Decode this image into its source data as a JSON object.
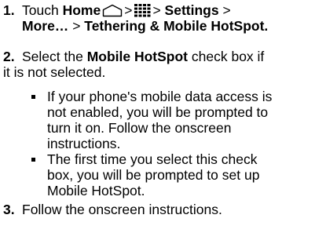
{
  "step1": {
    "number": "1.",
    "touch": "Touch",
    "home": "Home",
    "sep1": ">",
    "sep2": ">",
    "settings": "Settings",
    "sep3": ">",
    "more": "More…",
    "sep4": ">",
    "tethering": "Tethering & Mobile HotSpot",
    "end": ".",
    "icons": [
      "home-icon",
      "apps-grid-icon"
    ]
  },
  "step2": {
    "number": "2.",
    "select": "Select the",
    "checkbox_name": "Mobile HotSpot",
    "rest_line1": "check box if",
    "rest_line2": "it is not selected.",
    "bullets": [
      {
        "line1": "If your phone's mobile data access is",
        "line2": "not enabled, you will be prompted to",
        "line3": "turn it on. Follow the onscreen",
        "line4": "instructions."
      },
      {
        "line1": "The first time you select this check",
        "line2": "box, you will be prompted to set up",
        "line3": "Mobile HotSpot."
      }
    ]
  },
  "step3": {
    "number": "3.",
    "text": "Follow the onscreen instructions."
  }
}
